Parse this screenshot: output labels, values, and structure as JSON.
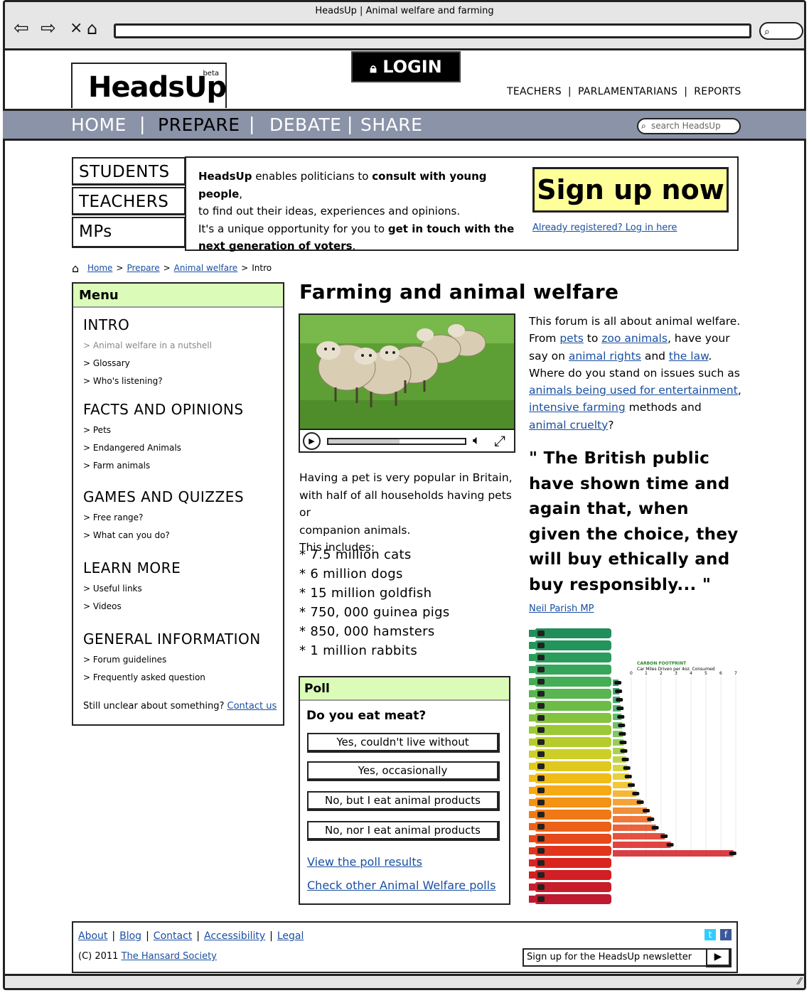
{
  "browser": {
    "title": "HeadsUp | Animal welfare and farming"
  },
  "header": {
    "logo": "HeadsUp",
    "beta": "beta",
    "login": "LOGIN",
    "toplinks": [
      "TEACHERS",
      "PARLAMENTARIANS",
      "REPORTS"
    ]
  },
  "nav": {
    "items": [
      "HOME",
      "PREPARE",
      "DEBATE",
      "SHARE"
    ],
    "active": "PREPARE",
    "search_placeholder": "search HeadsUp"
  },
  "banner": {
    "audiences": [
      "STUDENTS",
      "TEACHERS",
      "MPs"
    ],
    "line1_a": "HeadsUp",
    "line1_b": " enables politicians to ",
    "line1_c": "consult with young people",
    "line1_d": ",",
    "line2": "to find out their ideas, experiences and opinions.",
    "line3_a": "It's a unique opportunity for you to ",
    "line3_b": "get in touch with the",
    "line4_a": "next generation of voters",
    "line4_b": ".",
    "signup": "Sign up now",
    "already": "Already registered? Log in here"
  },
  "breadcrumb": [
    "Home",
    "Prepare",
    "Animal welfare",
    "Intro"
  ],
  "menu": {
    "title": "Menu",
    "sections": [
      {
        "title": "INTRO",
        "items": [
          "Animal welfare in a nutshell",
          "Glossary",
          "Who's listening?"
        ]
      },
      {
        "title": "FACTS AND OPINIONS",
        "items": [
          "Pets",
          "Endangered Animals",
          "Farm animals"
        ]
      },
      {
        "title": "GAMES AND QUIZZES",
        "items": [
          "Free range?",
          "What can you do?"
        ]
      },
      {
        "title": "LEARN MORE",
        "items": [
          "Useful links",
          "Videos"
        ]
      },
      {
        "title": "GENERAL INFORMATION",
        "items": [
          "Forum guidelines",
          "Frequently asked question"
        ]
      }
    ],
    "unclear": "Still unclear about something?",
    "contact": "Contact us"
  },
  "main": {
    "title": "Farming and animal welfare",
    "pet_text": [
      "Having a pet is very popular in Britain,",
      "with half of all households having pets or",
      "companion animals.",
      "This includes:"
    ],
    "facts": [
      "* 7.5 million cats",
      "* 6 million dogs",
      "* 15 million goldfish",
      "* 750, 000 guinea pigs",
      "* 850, 000 hamsters",
      "* 1 million rabbits"
    ]
  },
  "video": {
    "progress": 0.52
  },
  "poll": {
    "title": "Poll",
    "question": "Do you eat meat?",
    "options": [
      "Yes, couldn't live without",
      "Yes, occasionally",
      "No, but I eat animal products",
      "No, nor I eat animal products"
    ],
    "view_results": "View the poll results",
    "other_polls": "Check other Animal Welfare polls"
  },
  "forum": {
    "t1": "This forum is all about animal welfare. From ",
    "pets": "pets",
    "t2": " to ",
    "zoo": "zoo animals",
    "t3": ", have your say on ",
    "rights": "animal rights",
    "t4": " and ",
    "law": "the law",
    "t5": ". Where do you stand on issues such as ",
    "entertain": "animals being used for entertainment",
    "t6": ", ",
    "intensive": "intensive farming",
    "t7": " methods and ",
    "cruelty": "animal cruelty",
    "t8": "?"
  },
  "quote": {
    "text": "\" The British public have shown time and again that, when given the choice, they will buy ethically and buy responsibly... \"",
    "author": "Neil Parish MP"
  },
  "infographic": {
    "title": "CARBON FOOTPRINT",
    "subtitle": "Car Miles Driven per 4oz. Consumed",
    "ticks": [
      "0",
      "1",
      "2",
      "3",
      "4",
      "5",
      "6",
      "7"
    ]
  },
  "footer": {
    "links": [
      "About",
      "Blog",
      "Contact",
      "Accessibility",
      "Legal"
    ],
    "copyright": "(C) 2011",
    "society": "The Hansard Society",
    "newsletter": "Sign up for the HeadsUp newsletter",
    "colors": {
      "twitter": "#33ccff",
      "facebook": "#3b5998"
    }
  }
}
